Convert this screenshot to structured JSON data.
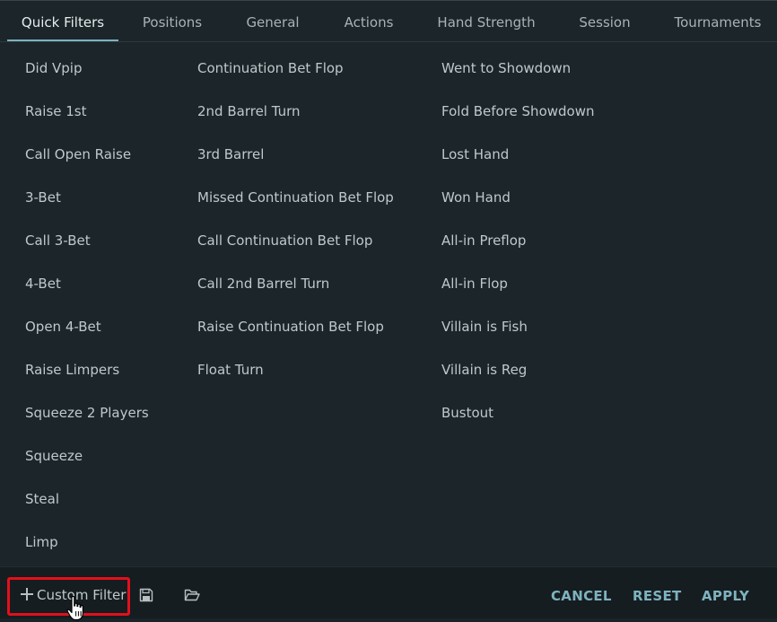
{
  "tabs": [
    {
      "label": "Quick Filters",
      "active": true
    },
    {
      "label": "Positions"
    },
    {
      "label": "General"
    },
    {
      "label": "Actions"
    },
    {
      "label": "Hand Strength"
    },
    {
      "label": "Session"
    },
    {
      "label": "Tournaments"
    }
  ],
  "filters": {
    "column1": [
      "Did Vpip",
      "Raise 1st",
      "Call Open Raise",
      "3-Bet",
      "Call 3-Bet",
      "4-Bet",
      "Open 4-Bet",
      "Raise Limpers",
      "Squeeze 2 Players",
      "Squeeze",
      "Steal",
      "Limp"
    ],
    "column2": [
      "Continuation Bet Flop",
      "2nd Barrel Turn",
      "3rd Barrel",
      "Missed Continuation Bet Flop",
      "Call Continuation Bet Flop",
      "Call 2nd Barrel Turn",
      "Raise Continuation Bet Flop",
      "Float Turn"
    ],
    "column3": [
      "Went to Showdown",
      "Fold Before Showdown",
      "Lost Hand",
      "Won Hand",
      "All-in Preflop",
      "All-in Flop",
      "Villain is Fish",
      "Villain is Reg",
      "Bustout"
    ]
  },
  "footer": {
    "custom_filter_label": "Custom Filter",
    "cancel_label": "CANCEL",
    "reset_label": "RESET",
    "apply_label": "APPLY"
  },
  "icons": {
    "plus": "plus-icon",
    "save": "save-icon",
    "folder": "folder-open-icon",
    "cursor": "hand-pointer-icon"
  },
  "colors": {
    "background": "#1c2529",
    "footer_background": "#151d20",
    "accent": "#7fb2bf",
    "highlight_border": "#e3101b",
    "text": "#bfc8cb"
  }
}
